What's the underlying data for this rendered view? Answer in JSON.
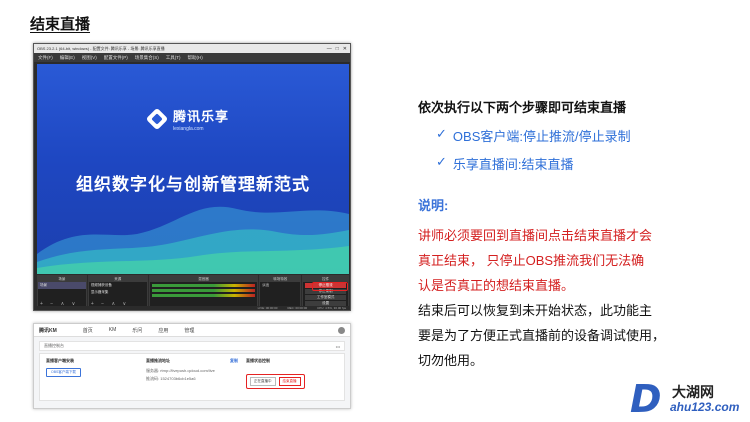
{
  "slide": {
    "title": "结束直播"
  },
  "obs": {
    "window_title": "OBS 23.2.1 (64-bit, windows) - 配置文件: 腾讯乐享 - 场景: 腾讯乐享直播",
    "window_controls": [
      "—",
      "□",
      "✕"
    ],
    "menu": [
      "文件(F)",
      "编辑(E)",
      "视图(V)",
      "配置文件(P)",
      "场景集合(S)",
      "工具(T)",
      "帮助(H)"
    ],
    "preview": {
      "brand_name": "腾讯乐享",
      "brand_url": "lexiangla.com",
      "headline": "组织数字化与创新管理新范式"
    },
    "docks": {
      "scenes_title": "场景",
      "scenes": [
        "场景"
      ],
      "sources_title": "来源",
      "sources": [
        "视频捕获设备",
        "显示器采集"
      ],
      "mixer_title": "混音器",
      "transitions_title": "转场特效",
      "transition_value": "淡出",
      "controls_title": "控件",
      "controls": [
        "停止推流",
        "停止录制",
        "工作室模式",
        "设置",
        "退出"
      ],
      "dock_footer": "+ − ∧ ∨"
    },
    "status": [
      "LIVE: 00:00:00",
      "REC: 00:00:00",
      "CPU: 4.5%, 30.00 fps"
    ]
  },
  "web": {
    "logo": "腾讯KM",
    "nav": [
      "首页",
      "KM",
      "乐问",
      "应用",
      "管理"
    ],
    "bar_label": "直播控制台",
    "bar_more": "•••",
    "cards": {
      "schedule_title": "直播客户端安装",
      "schedule_button": "OBS客户端下载",
      "push_title": "直播推流地址",
      "push_link": "复制",
      "push_server": "服务器: rtmp://livepush.qcloud.com/live",
      "push_key": "推流码: 1524703b6cb1e5a6",
      "status_title": "直播状态控制",
      "status_live": "正在直播中",
      "status_end": "结束直播"
    }
  },
  "instructions": {
    "heading": "依次执行以下两个步骤即可结束直播",
    "steps": [
      {
        "mark": "✓",
        "text": "OBS客户端:停止推流/停止录制"
      },
      {
        "mark": "✓",
        "text": "乐享直播间:结束直播"
      }
    ],
    "note_title": "说明:",
    "warning_lines": [
      "讲师必须要回到直播间点击结束直播才会",
      "真正结束，  只停止OBS推流我们无法确",
      "认是否真正的想结束直播。"
    ],
    "body_lines": [
      "结束后可以恢复到未开始状态，此功能主",
      "要是为了方便正式直播前的设备调试使用，",
      "切勿他用。"
    ]
  },
  "watermark": {
    "cn": "大湖网",
    "en": "ahu123.com",
    "letter": "D"
  },
  "colors": {
    "accent_blue": "#2e6fd8",
    "warning_red": "#d42020",
    "highlight_red": "#e52222",
    "preview_blue": "#2a5ad6"
  }
}
